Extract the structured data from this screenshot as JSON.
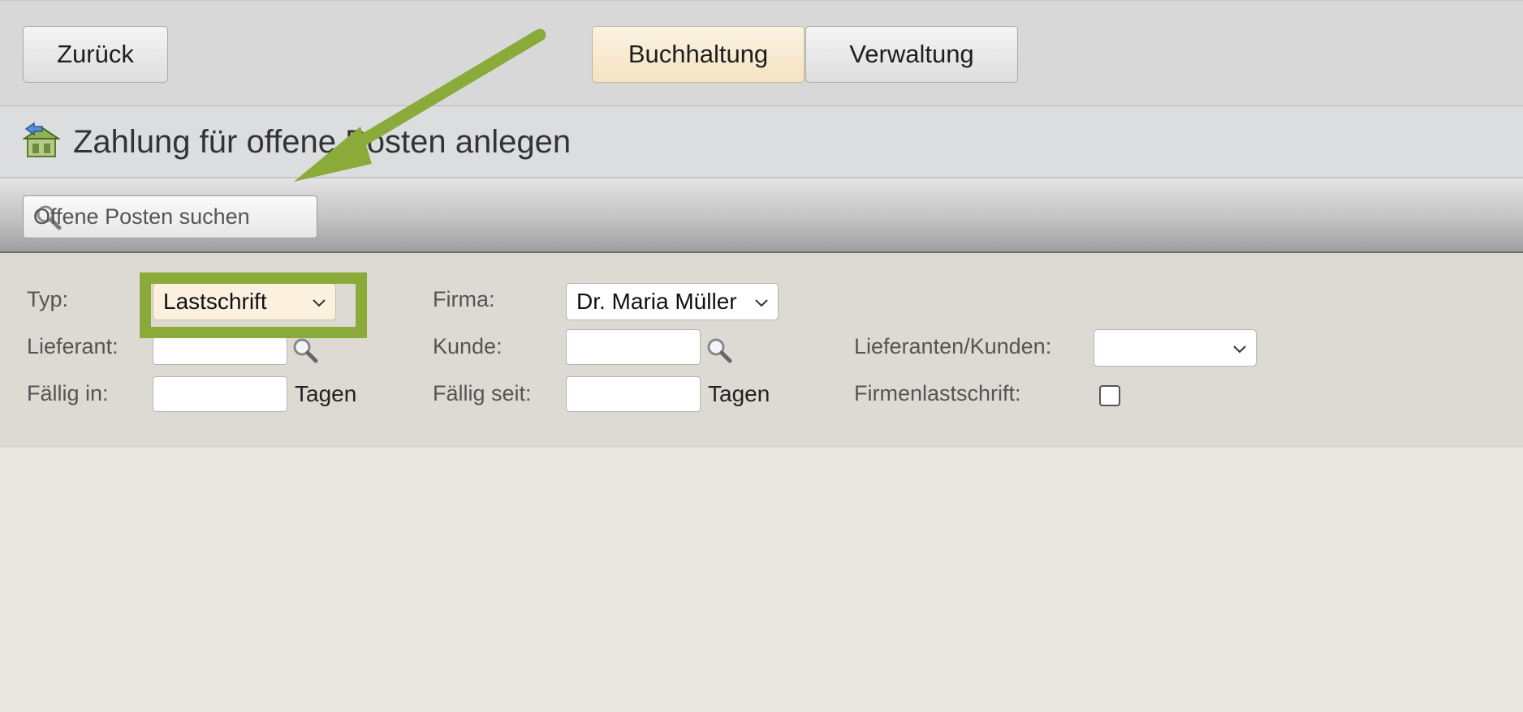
{
  "header": {
    "back_label": "Zurück",
    "tabs": [
      {
        "label": "Buchhaltung",
        "active": true
      },
      {
        "label": "Verwaltung",
        "active": false
      }
    ]
  },
  "page": {
    "title": "Zahlung für offene Posten anlegen",
    "title_icon": "payment-open-items-icon"
  },
  "toolbar": {
    "search_button_label": "Offene Posten suchen",
    "search_icon": "magnifier-icon"
  },
  "form": {
    "typ": {
      "label": "Typ:",
      "value": "Lastschrift"
    },
    "firma": {
      "label": "Firma:",
      "value": "Dr. Maria Müller"
    },
    "lieferant": {
      "label": "Lieferant:",
      "value": ""
    },
    "kunde": {
      "label": "Kunde:",
      "value": ""
    },
    "lieferanten_kunden": {
      "label": "Lieferanten/Kunden:",
      "value": ""
    },
    "faellig_in": {
      "label": "Fällig in:",
      "value": "",
      "unit": "Tagen"
    },
    "faellig_seit": {
      "label": "Fällig seit:",
      "value": "",
      "unit": "Tagen"
    },
    "firmenlastschrift": {
      "label": "Firmenlastschrift:",
      "checked": false
    }
  },
  "annotation": {
    "color": "#8aaa3a",
    "highlight": "Typ select"
  },
  "colors": {
    "active_tab": "#f5e3c2",
    "topbar": "#d8d8d9",
    "form_panel": "#dcdad3",
    "page_bg": "#e8e7e2"
  }
}
